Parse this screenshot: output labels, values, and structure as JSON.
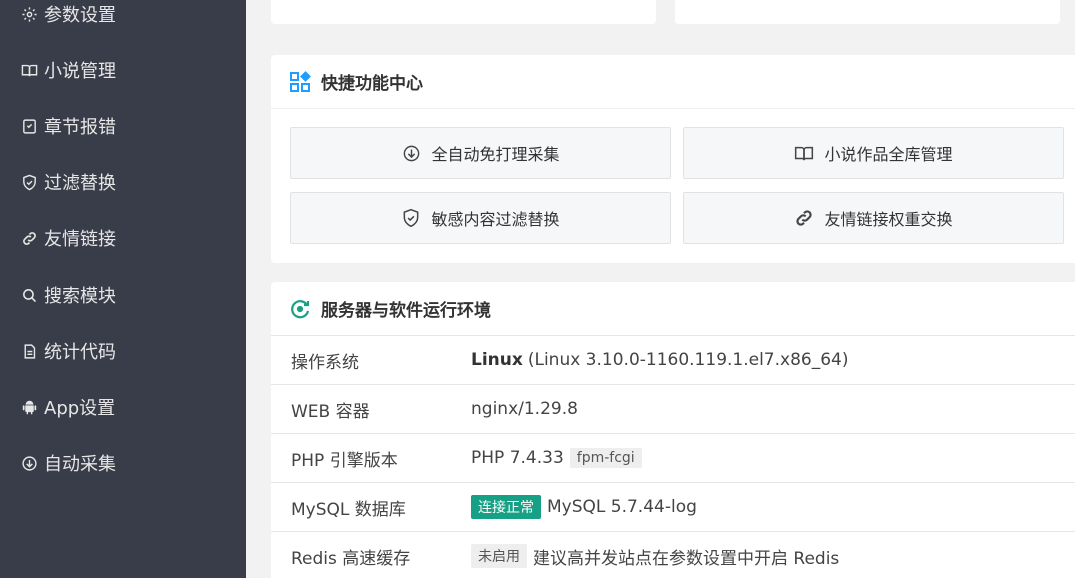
{
  "sidebar": {
    "items": [
      {
        "label": "参数设置",
        "icon": "gear-icon"
      },
      {
        "label": "小说管理",
        "icon": "book-icon"
      },
      {
        "label": "章节报错",
        "icon": "report-icon"
      },
      {
        "label": "过滤替换",
        "icon": "shield-icon"
      },
      {
        "label": "友情链接",
        "icon": "link-icon"
      },
      {
        "label": "搜索模块",
        "icon": "search-icon"
      },
      {
        "label": "统计代码",
        "icon": "document-icon"
      },
      {
        "label": "App设置",
        "icon": "android-icon"
      },
      {
        "label": "自动采集",
        "icon": "download-circle-icon"
      }
    ]
  },
  "quick": {
    "title": "快捷功能中心",
    "buttons": [
      {
        "label": "全自动免打理采集",
        "icon": "download-circle-icon"
      },
      {
        "label": "小说作品全库管理",
        "icon": "book-icon"
      },
      {
        "label": "敏感内容过滤替换",
        "icon": "shield-check-icon"
      },
      {
        "label": "友情链接权重交换",
        "icon": "link-icon"
      }
    ]
  },
  "env": {
    "title": "服务器与软件运行环境",
    "rows": [
      {
        "key": "操作系统",
        "value_bold": "Linux",
        "value": "(Linux 3.10.0-1160.119.1.el7.x86_64)"
      },
      {
        "key": "WEB 容器",
        "value": "nginx/1.29.8"
      },
      {
        "key": "PHP 引擎版本",
        "value": "PHP 7.4.33",
        "tag": "fpm-fcgi"
      },
      {
        "key": "MySQL 数据库",
        "status": "连接正常",
        "value": "MySQL 5.7.44-log"
      },
      {
        "key": "Redis 高速缓存",
        "status": "未启用",
        "value": "建议高并发站点在参数设置中开启 Redis"
      }
    ]
  },
  "colors": {
    "sidebar_bg": "#393d49",
    "accent_blue": "#1e9fff",
    "status_green": "#16a085"
  }
}
